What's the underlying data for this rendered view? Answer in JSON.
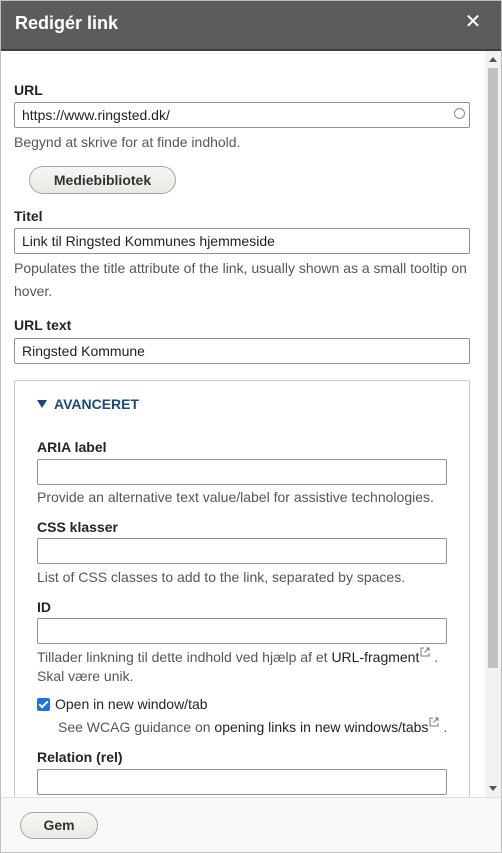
{
  "dialog": {
    "title": "Redigér link",
    "close_glyph": "✕"
  },
  "url": {
    "label": "URL",
    "value": "https://www.ringsted.dk/",
    "description": "Begynd at skrive for at finde indhold."
  },
  "media_button": "Mediebibliotek",
  "titel": {
    "label": "Titel",
    "value": "Link til Ringsted Kommunes hjemmeside",
    "description_line1": "Populates the title attribute of the link, usually shown as a small tooltip on",
    "description_line2": "hover."
  },
  "url_text": {
    "label": "URL text",
    "value": "Ringsted Kommune"
  },
  "advanced": {
    "summary": "AVANCERET",
    "aria": {
      "label": "ARIA label",
      "value": "",
      "description": "Provide an alternative text value/label for assistive technologies."
    },
    "css": {
      "label": "CSS klasser",
      "value": "",
      "description": "List of CSS classes to add to the link, separated by spaces."
    },
    "id": {
      "label": "ID",
      "value": "",
      "description_prefix": "Tillader linkning til dette indhold ved hjælp af et",
      "description_link": "URL-fragment",
      "description_suffix": ".",
      "description_line2": "Skal være unik."
    },
    "new_window": {
      "label": "Open in new window/tab",
      "checked": true,
      "help_prefix": "See WCAG guidance on",
      "help_link": "opening links in new windows/tabs",
      "help_suffix": "."
    },
    "rel": {
      "label": "Relation (rel)",
      "value": ""
    }
  },
  "footer": {
    "save_label": "Gem"
  },
  "icons": {
    "close": "close-icon",
    "loader": "autocomplete-throbber-icon",
    "expand": "triangle-down-icon",
    "external": "external-link-icon"
  },
  "colors": {
    "titlebar": "#5c5c5c",
    "accent_link": "#1a4a7a",
    "checkbox": "#1a73e8"
  }
}
